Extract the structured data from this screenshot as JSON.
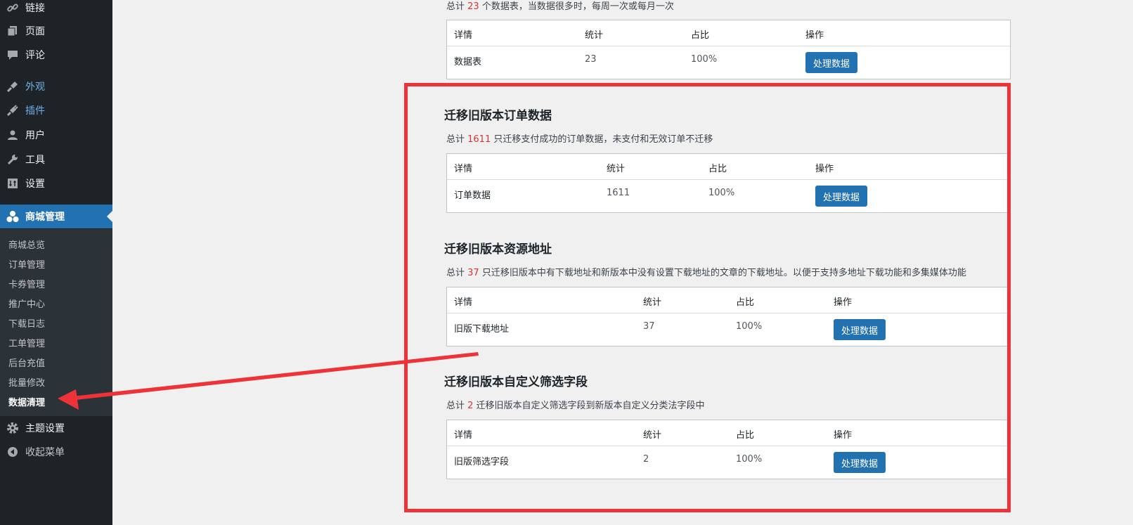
{
  "sidebar": {
    "items": [
      {
        "label": "链接",
        "icon": "link-icon"
      },
      {
        "label": "页面",
        "icon": "pages-icon"
      },
      {
        "label": "评论",
        "icon": "comments-icon"
      },
      {
        "label": "外观",
        "icon": "appearance-icon"
      },
      {
        "label": "插件",
        "icon": "plugins-icon"
      },
      {
        "label": "用户",
        "icon": "users-icon"
      },
      {
        "label": "工具",
        "icon": "tools-icon"
      },
      {
        "label": "设置",
        "icon": "settings-icon"
      },
      {
        "label": "商城管理",
        "icon": "shop-icon"
      },
      {
        "label": "主题设置",
        "icon": "gear-icon"
      },
      {
        "label": "收起菜单",
        "icon": "collapse-icon"
      }
    ],
    "submenu": [
      "商城总览",
      "订单管理",
      "卡券管理",
      "推广中心",
      "下载日志",
      "工单管理",
      "后台充值",
      "批量修改",
      "数据清理"
    ]
  },
  "table_headers": {
    "detail": "详情",
    "stat": "统计",
    "ratio": "占比",
    "action": "操作"
  },
  "button_label": "处理数据",
  "sections": [
    {
      "title": "",
      "intro_prefix": "总计 ",
      "count": "23",
      "intro_suffix": " 个数据表，当数据很多时，每周一次或每月一次",
      "row": {
        "detail": "数据表",
        "stat": "23",
        "ratio": "100%"
      }
    },
    {
      "title": "迁移旧版本订单数据",
      "intro_prefix": "总计 ",
      "count": "1611",
      "intro_suffix": " 只迁移支付成功的订单数据，未支付和无效订单不迁移",
      "row": {
        "detail": "订单数据",
        "stat": "1611",
        "ratio": "100%"
      }
    },
    {
      "title": "迁移旧版本资源地址",
      "intro_prefix": "总计 ",
      "count": "37",
      "intro_suffix": " 只迁移旧版本中有下载地址和新版本中没有设置下载地址的文章的下载地址。以便于支持多地址下载功能和多集媒体功能",
      "row": {
        "detail": "旧版下载地址",
        "stat": "37",
        "ratio": "100%"
      }
    },
    {
      "title": "迁移旧版本自定义筛选字段",
      "intro_prefix": "总计 ",
      "count": "2",
      "intro_suffix": " 迁移旧版本自定义筛选字段到新版本自定义分类法字段中",
      "row": {
        "detail": "旧版筛选字段",
        "stat": "2",
        "ratio": "100%"
      }
    }
  ],
  "colors": {
    "accent": "#2271b1",
    "highlight": "#ee3338",
    "sidebar": "#1d2327",
    "count": "#d63638"
  }
}
